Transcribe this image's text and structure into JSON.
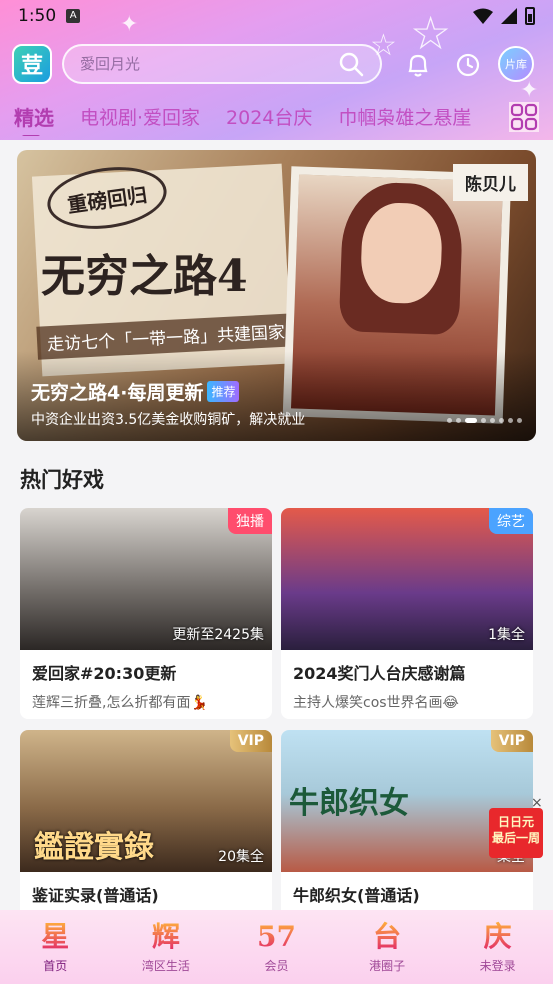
{
  "status_bar": {
    "time": "1:50",
    "a_badge": "A"
  },
  "header": {
    "logo_text": "荳",
    "search_placeholder": "愛回月光",
    "library_label": "片库"
  },
  "tabs": [
    {
      "label": "精选",
      "active": true
    },
    {
      "label": "电视剧·爱回家",
      "active": false
    },
    {
      "label": "2024台庆",
      "active": false
    },
    {
      "label": "巾帼枭雄之悬崖",
      "active": false
    }
  ],
  "banner": {
    "stamp_text": "重磅回归",
    "poster_title": "无穷之路4",
    "poster_slogan": "走访七个「一带一路」共建国家",
    "host_name": "陈贝儿",
    "title": "无穷之路4·每周更新",
    "tag": "推荐",
    "subtitle": "中资企业出资3.5亿美金收购铜矿，解决就业",
    "dots_count": 8,
    "active_dot": 2
  },
  "section": {
    "title": "热门好戏",
    "cards": [
      {
        "title": "爱回家#20:30更新",
        "subtitle": "莲辉三折叠,怎么折都有面💃",
        "badge": "独播",
        "badge_type": "exclusive",
        "episodes": "更新至2425集"
      },
      {
        "title": "2024奖门人台庆感谢篇",
        "subtitle": "主持人爆笑cos世界名画😂",
        "badge": "综艺",
        "badge_type": "variety",
        "episodes": "1集全"
      },
      {
        "title": "鉴证实录(普通话)",
        "subtitle": "",
        "badge": "VIP",
        "badge_type": "vip",
        "episodes": "20集全",
        "poster_text": "鑑證實錄"
      },
      {
        "title": "牛郎织女(普通话)",
        "subtitle": "",
        "badge": "VIP",
        "badge_type": "vip",
        "episodes": "集全",
        "poster_text": "牛郎织女"
      }
    ]
  },
  "promo": {
    "line1": "日日元",
    "line2": "最后一周",
    "close": "×"
  },
  "bottom_nav": [
    {
      "glyph": "星",
      "label": "首页",
      "active": true
    },
    {
      "glyph": "辉",
      "label": "湾区生活",
      "active": false
    },
    {
      "glyph": "57",
      "label": "会员",
      "active": false
    },
    {
      "glyph": "台",
      "label": "港圈子",
      "active": false
    },
    {
      "glyph": "庆",
      "label": "未登录",
      "active": false
    }
  ]
}
